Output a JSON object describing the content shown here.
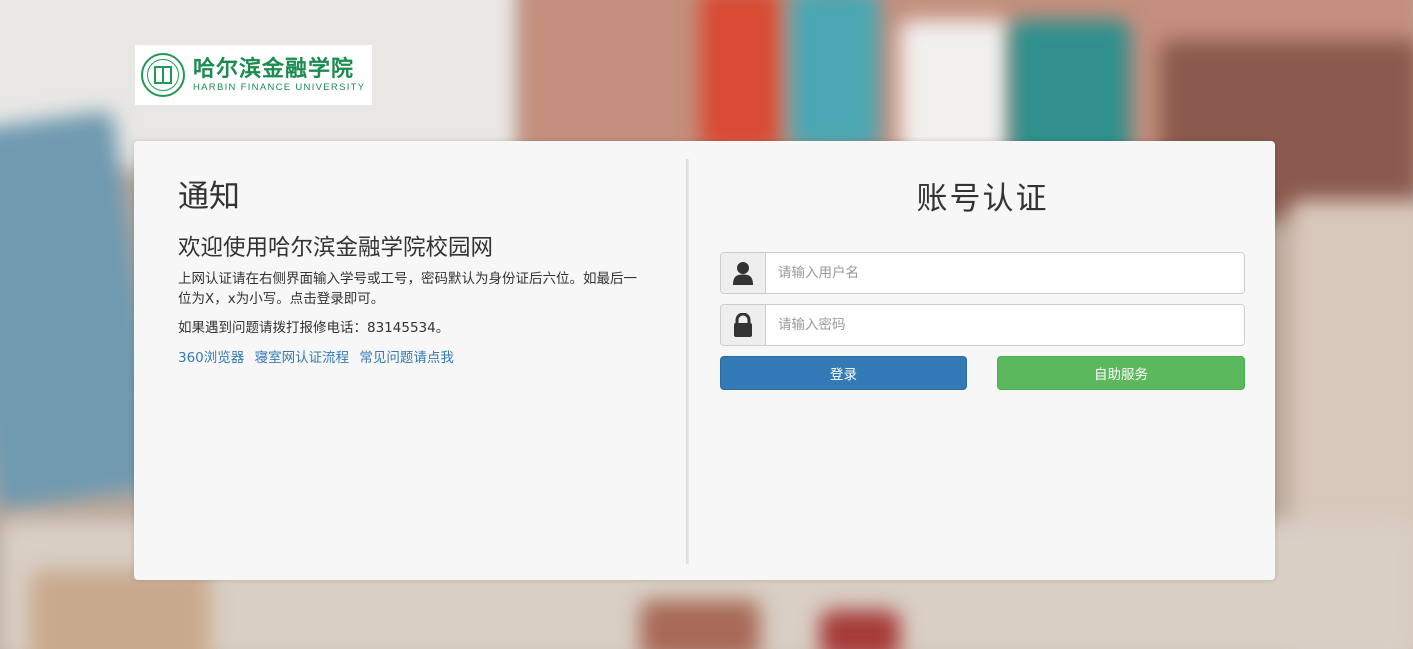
{
  "logo": {
    "name_cn": "哈尔滨金融学院",
    "name_en": "HARBIN FINANCE UNIVERSITY"
  },
  "notice": {
    "title": "通知",
    "subtitle": "欢迎使用哈尔滨金融学院校园网",
    "text": "上网认证请在右侧界面输入学号或工号，密码默认为身份证后六位。如最后一位为X，x为小写。点击登录即可。",
    "phone": "如果遇到问题请拨打报修电话：83145534。",
    "links": [
      {
        "label": "360浏览器"
      },
      {
        "label": "寝室网认证流程"
      },
      {
        "label": "常见问题请点我"
      }
    ]
  },
  "auth": {
    "title": "账号认证",
    "username_placeholder": "请输入用户名",
    "username_value": "",
    "password_placeholder": "请输入密码",
    "password_value": "",
    "login_label": "登录",
    "self_service_label": "自助服务"
  },
  "colors": {
    "primary": "#337ab7",
    "success": "#5cb85c",
    "brand_green": "#1a8c4f",
    "link": "#337ab7"
  },
  "icons": {
    "username": "user-icon",
    "password": "lock-icon"
  }
}
